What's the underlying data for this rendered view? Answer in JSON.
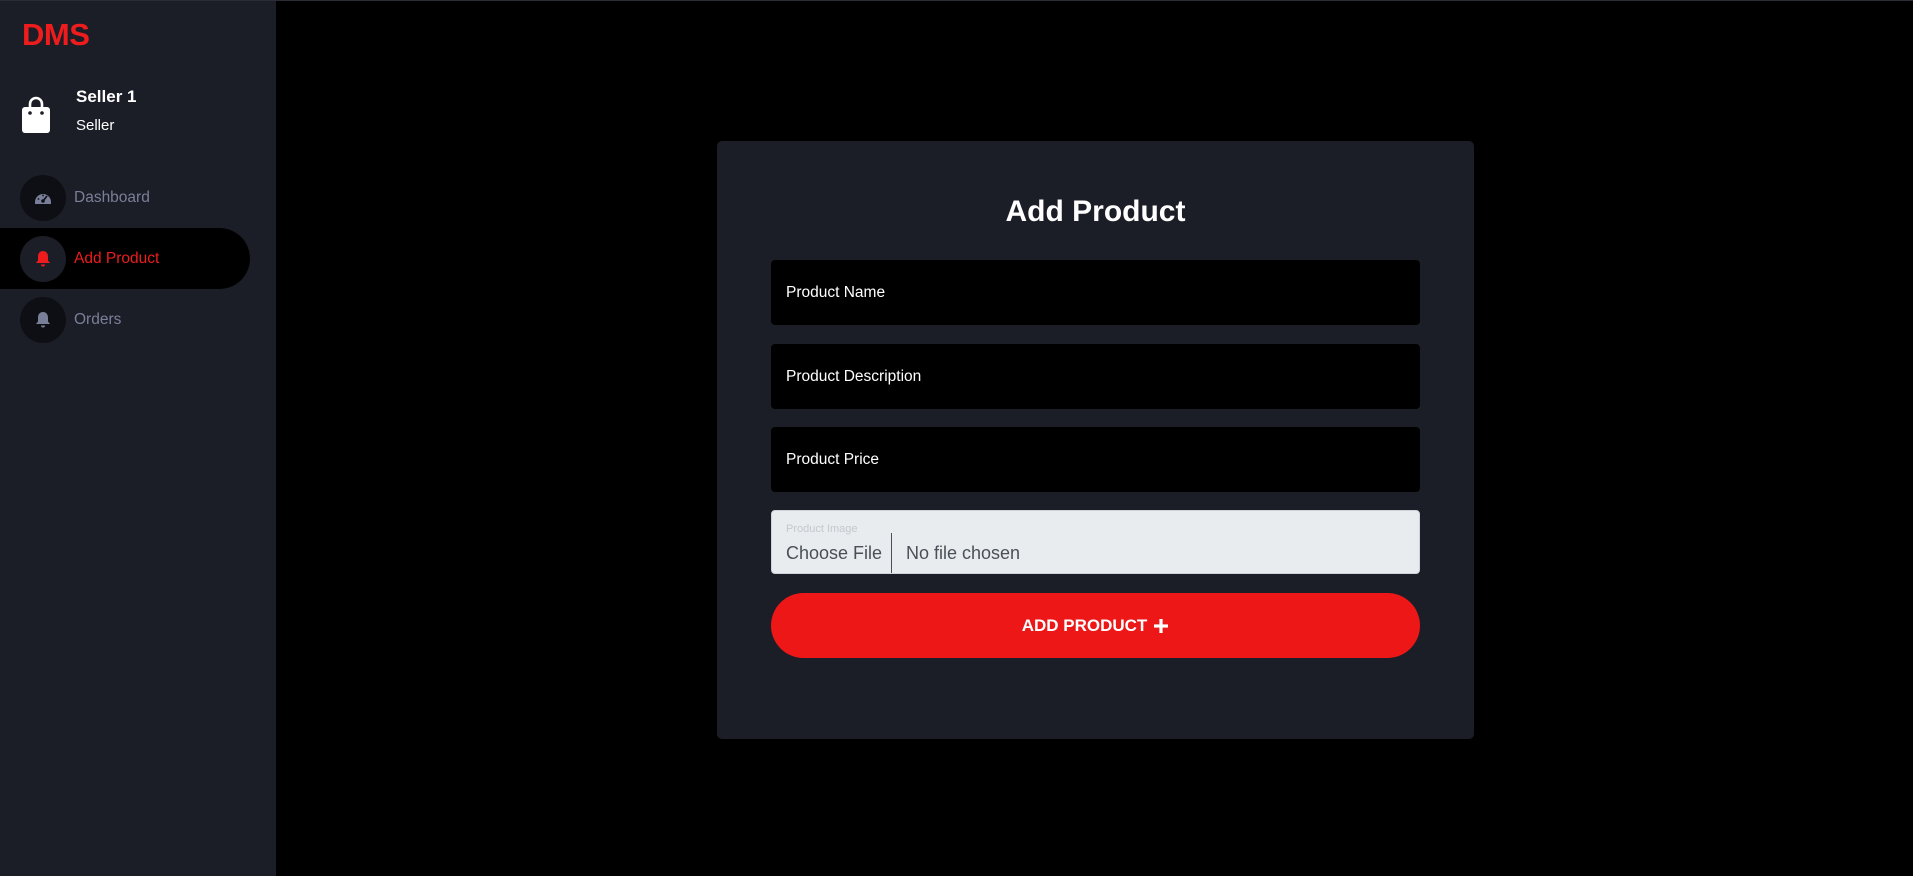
{
  "brand": {
    "name": "DMS",
    "color": "#ee1c1c"
  },
  "user": {
    "name": "Seller 1",
    "role": "Seller",
    "icon": "shopping-bag-icon"
  },
  "nav": {
    "items": [
      {
        "label": "Dashboard",
        "icon": "speedometer-icon",
        "active": false
      },
      {
        "label": "Add Product",
        "icon": "bell-icon",
        "active": true
      },
      {
        "label": "Orders",
        "icon": "bell-icon",
        "active": false
      }
    ]
  },
  "form": {
    "title": "Add Product",
    "name_placeholder": "Product Name",
    "description_placeholder": "Product Description",
    "price_placeholder": "Product Price",
    "image_label": "Product Image",
    "choose_file_label": "Choose File",
    "file_status": "No file chosen",
    "submit_label": "ADD PRODUCT",
    "submit_icon": "plus-icon",
    "accent_color": "#ee1717"
  }
}
